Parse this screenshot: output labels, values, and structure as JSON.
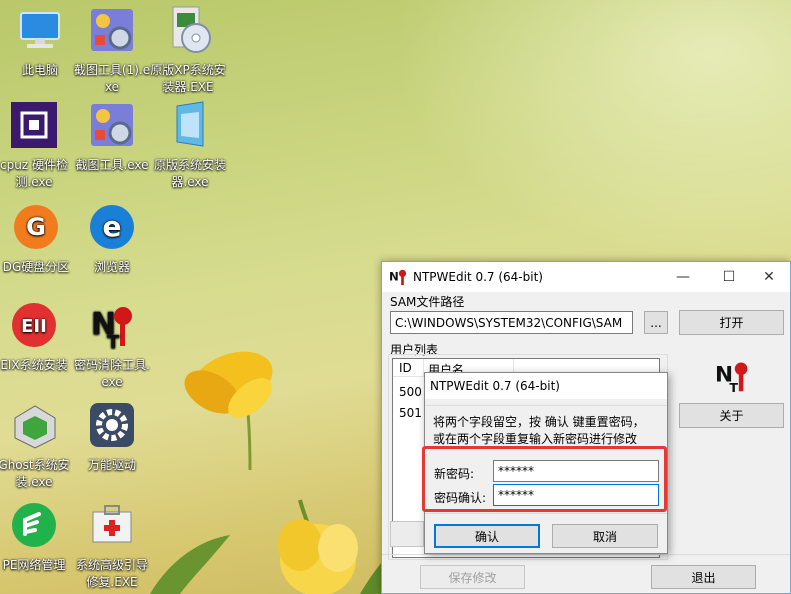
{
  "desktop": {
    "icons": [
      {
        "label": "此电脑",
        "icon": "this-pc-icon"
      },
      {
        "label": "截图工具(1).exe",
        "icon": "screenshot-tool-icon"
      },
      {
        "label": "原版XP系统安装器.EXE",
        "icon": "xp-installer-icon"
      },
      {
        "label": "cpuz 硬件检测.exe",
        "icon": "cpuz-icon"
      },
      {
        "label": "截图工具.exe",
        "icon": "screenshot-tool-icon"
      },
      {
        "label": "原版系统安装器.exe",
        "icon": "system-installer-icon"
      },
      {
        "label": "DG硬盘分区",
        "icon": "diskgenius-icon"
      },
      {
        "label": "浏览器",
        "icon": "browser-icon"
      },
      {
        "label": "EIX系统安装",
        "icon": "eix-installer-icon"
      },
      {
        "label": "密码清除工具.exe",
        "icon": "password-clear-icon"
      },
      {
        "label": "Ghost系统安装.exe",
        "icon": "ghost-installer-icon"
      },
      {
        "label": "万能驱动",
        "icon": "driver-gear-icon"
      },
      {
        "label": "PE网络管理",
        "icon": "pe-network-icon"
      },
      {
        "label": "系统高级引导修复.EXE",
        "icon": "boot-repair-icon"
      }
    ]
  },
  "window": {
    "title": "NTPWEdit 0.7 (64-bit)",
    "minimize": "—",
    "maximize": "☐",
    "close": "✕",
    "sam_label": "SAM文件路径",
    "sam_path": "C:\\WINDOWS\\SYSTEM32\\CONFIG\\SAM",
    "browse_label": "...",
    "open_label": "打开",
    "users_label": "用户列表",
    "col_id": "ID",
    "col_user": "用户名",
    "rows": [
      {
        "id": "500"
      },
      {
        "id": "501"
      }
    ],
    "about_label": "关于",
    "save_label": "保存修改",
    "exit_label": "退出"
  },
  "dialog": {
    "title": "NTPWEdit 0.7 (64-bit)",
    "instruction_1": "将两个字段留空，按 确认 键重置密码，",
    "instruction_2": "或在两个字段重复输入新密码进行修改",
    "new_password_label": "新密码:",
    "new_password_value": "******",
    "confirm_password_label": "密码确认:",
    "confirm_password_value": "******",
    "ok_label": "确认",
    "cancel_label": "取消"
  },
  "colors": {
    "accent": "#0078d7",
    "highlight": "#e53935"
  }
}
